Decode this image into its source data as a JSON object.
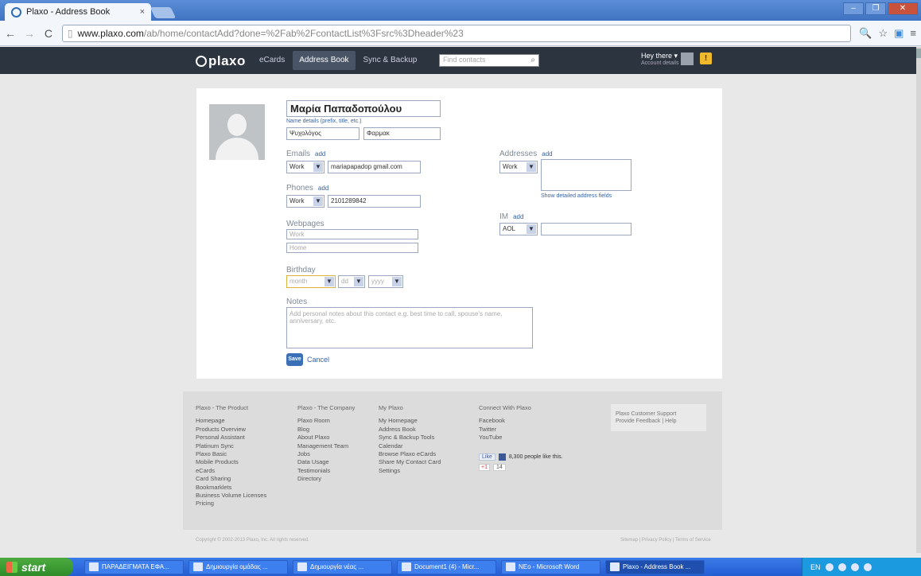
{
  "browser": {
    "tab_title": "Plaxo - Address Book",
    "tab_close": "×",
    "url_domain": "www.plaxo.com",
    "url_path": "/ab/home/contactAdd?done=%2Fab%2FcontactList%3Fsrc%3Dheader%23",
    "window_buttons": [
      "–",
      "❐",
      "✕"
    ]
  },
  "plaxo_header": {
    "logo": "plaxo",
    "nav": [
      "eCards",
      "Address Book",
      "Sync & Backup"
    ],
    "active_nav": "Address Book",
    "search_placeholder": "Find contacts",
    "user_name": "Hey there ▾",
    "user_sub": "Account details",
    "notif_count": "!"
  },
  "contact": {
    "full_name": "Μαρία Παπαδοπούλου",
    "name_link": "Name details (prefix, title, etc.)",
    "first_name": "Ψυχολόγος",
    "company": "Φαρμακ",
    "emails_label": "Emails",
    "phones_label": "Phones",
    "webpages_label": "Webpages",
    "birthday_label": "Birthday",
    "notes_label": "Notes",
    "addresses_label": "Addresses",
    "im_label": "IM",
    "add_label": "add",
    "email_type": "Work",
    "email_value": "mariapapadop gmail.com",
    "phone_type": "Work",
    "phone_value": "2101289842",
    "webpage_work_placeholder": "Work",
    "webpage_home_placeholder": "Home",
    "birthday_month": "month",
    "birthday_day": "dd",
    "birthday_year": "yyyy",
    "notes_placeholder": "Add personal notes about this contact e.g. best time to call, spouse's name, anniversary, etc.",
    "address_type": "Work",
    "address_link": "Show detailed address fields",
    "im_type": "AOL",
    "save_label": "Save",
    "cancel_label": "Cancel"
  },
  "footer": {
    "columns": [
      {
        "heading": "Plaxo - The Product",
        "items": [
          "Homepage",
          "Products Overview",
          "Personal Assistant",
          "Platinum Sync",
          "Plaxo Basic",
          "Mobile Products",
          "eCards",
          "Card Sharing",
          "Bookmarklets",
          "Business Volume Licenses",
          "Pricing"
        ]
      },
      {
        "heading": "Plaxo - The Company",
        "items": [
          "Plaxo Room",
          "Blog",
          "About Plaxo",
          "Management Team",
          "Jobs",
          "Data Usage",
          "Testimonials",
          "Directory"
        ]
      },
      {
        "heading": "My Plaxo",
        "items": [
          "My Homepage",
          "Address Book",
          "Sync & Backup Tools",
          "Calendar",
          "Browse Plaxo eCards",
          "Share My Contact Card",
          "Settings"
        ]
      },
      {
        "heading": "Connect With Plaxo",
        "items": [
          "Facebook",
          "Twitter",
          "YouTube"
        ]
      }
    ],
    "like_label": "Like",
    "fb_text": "8,300 people like this.",
    "gplus_label": "+1",
    "gplus_count": "14",
    "support_line1": "Plaxo Customer Support",
    "support_line2": "Provide Feedback | Help",
    "copyright": "Copyright © 2002-2013 Plaxo, Inc. All rights reserved.",
    "legal": "Sitemap | Privacy Policy | Terms of Service"
  },
  "taskbar": {
    "start": "start",
    "tasks": [
      "ΠΑΡΑΔΕΙΓΜΑΤΑ ΕΦΑ...",
      "Δημιουργία ομάδας ...",
      "Δημιουργία νέας ...",
      "Document1 (4) - Micr...",
      "NEo - Microsoft Word",
      "Plaxo - Address Book ..."
    ],
    "tray_lang": "EN"
  }
}
